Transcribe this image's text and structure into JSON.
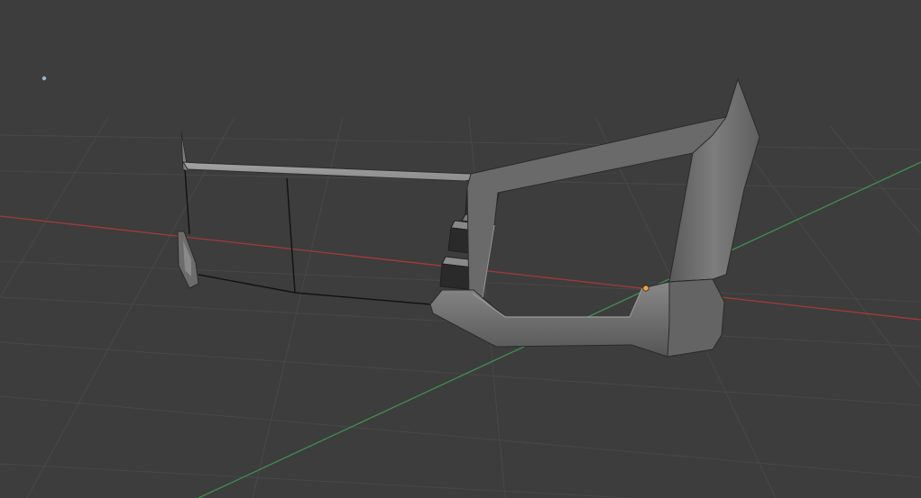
{
  "viewport": {
    "background_color": "#3d3d3d",
    "grid_color": "#4a4a4a",
    "x_axis_color": "#a33a3a",
    "y_axis_color": "#3f8f4e"
  },
  "scene_object": {
    "type": "3d-mesh-bumper-guard",
    "edit_mode": "partial-mesh-wireframe",
    "surface_color": "#6b6b6b",
    "highlight_color": "#bdbdbd"
  },
  "origin_point_color": "#f2a63a",
  "light_point_color": "#9ab6d6"
}
